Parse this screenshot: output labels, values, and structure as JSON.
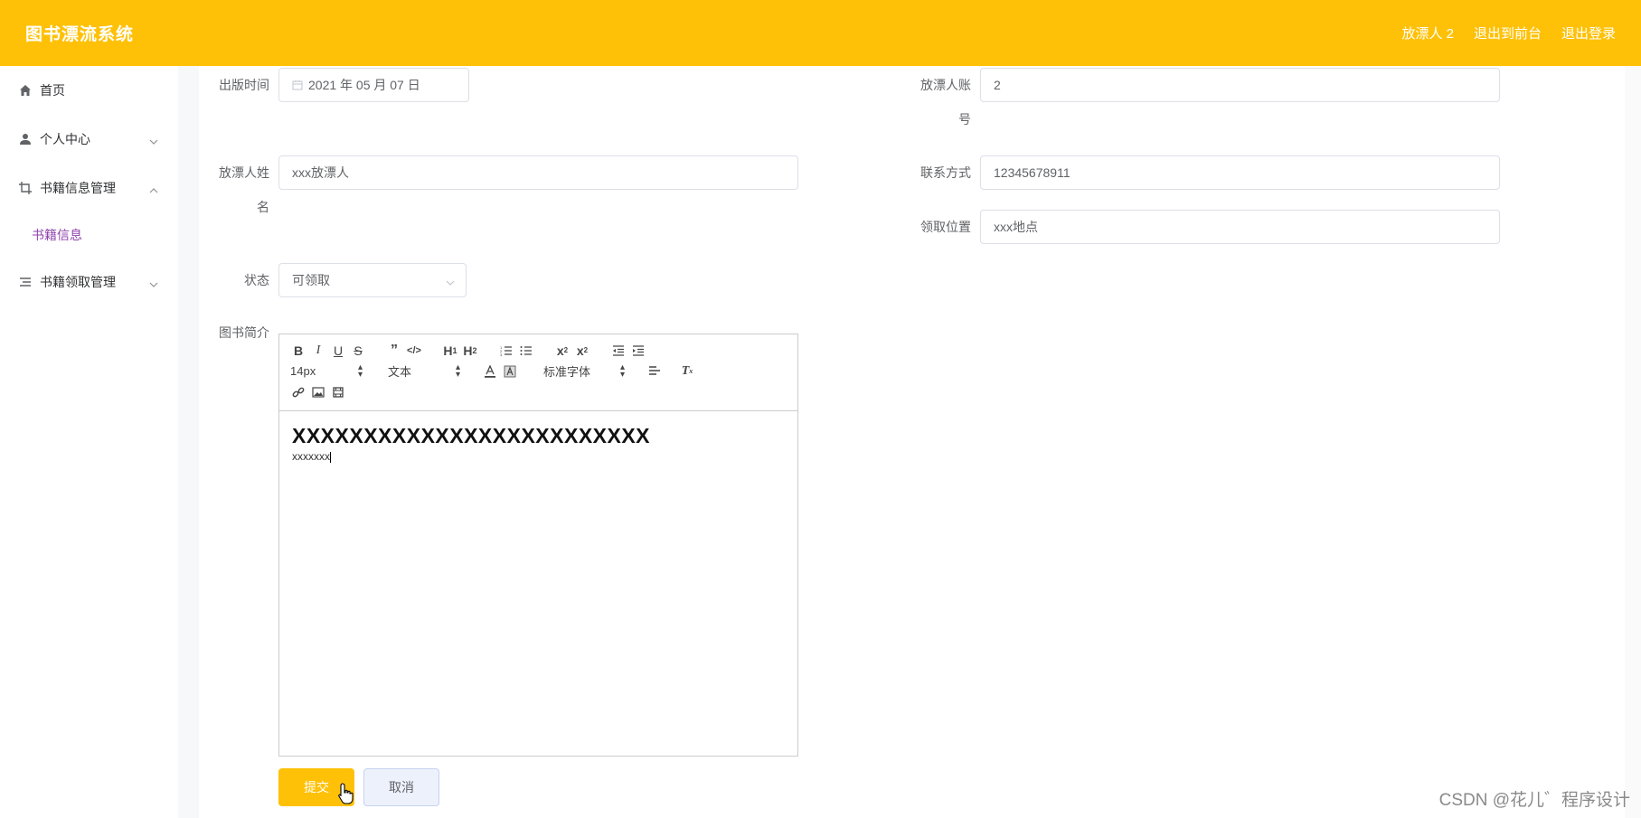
{
  "header": {
    "app_title": "图书漂流系统",
    "user_label": "放漂人 2",
    "goto_front_label": "退出到前台",
    "logout_label": "退出登录"
  },
  "sidebar": {
    "items": [
      {
        "label": "首页",
        "icon": "home-icon"
      },
      {
        "label": "个人中心",
        "icon": "user-icon"
      },
      {
        "label": "书籍信息管理",
        "icon": "crop-icon"
      },
      {
        "label": "书籍领取管理",
        "icon": "list-icon"
      }
    ],
    "sub_items": [
      {
        "label": "书籍信息"
      }
    ]
  },
  "form": {
    "publish_time": {
      "label": "出版时间",
      "value": "2021 年 05 月 07 日"
    },
    "account": {
      "label": "放漂人账号",
      "value": "2"
    },
    "name": {
      "label": "放漂人姓名",
      "value": "xxx放漂人"
    },
    "contact": {
      "label": "联系方式",
      "value": "12345678911"
    },
    "location": {
      "label": "领取位置",
      "value": "xxx地点"
    },
    "status": {
      "label": "状态",
      "value": "可领取"
    },
    "intro_label": "图书简介"
  },
  "editor": {
    "font_size": "14px",
    "block_type": "文本",
    "font_family": "标准字体",
    "heading_text": "XXXXXXXXXXXXXXXXXXXXXXXXX",
    "body_text": "xxxxxxx"
  },
  "buttons": {
    "submit_label": "提交",
    "cancel_label": "取消"
  },
  "watermark": "CSDN @花儿゛程序设计",
  "colors": {
    "header_bg": "#ffc107",
    "submenu_active": "#8e44ad"
  }
}
